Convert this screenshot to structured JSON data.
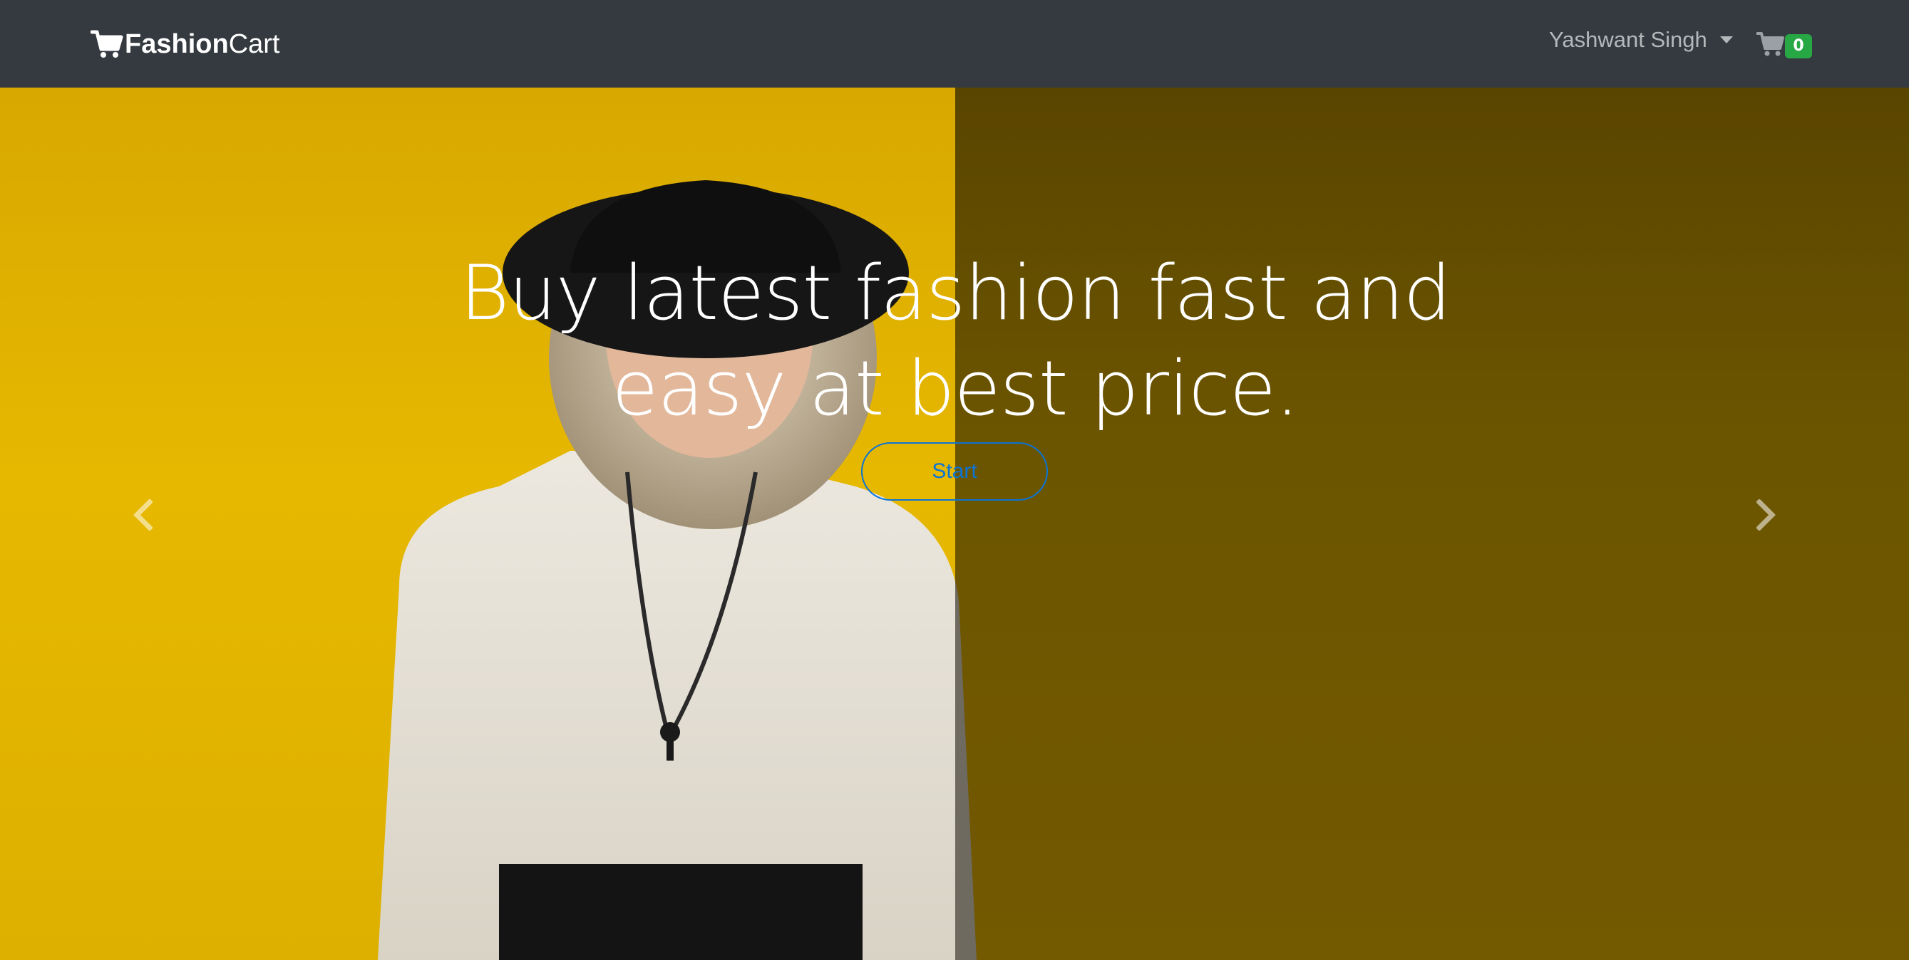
{
  "navbar": {
    "brand_bold": "Fashion",
    "brand_light": "Cart",
    "brand_icon": "shopping-cart-icon",
    "user_name": "Yashwant Singh",
    "cart_icon": "shopping-cart-icon",
    "cart_count": "0"
  },
  "hero": {
    "headline_line1": "Buy latest fashion fast and",
    "headline_line2": "easy at best price.",
    "start_label": "Start",
    "prev_icon": "chevron-left-icon",
    "next_icon": "chevron-right-icon"
  },
  "colors": {
    "navbar_bg": "#343a40",
    "badge_bg": "#28a745",
    "button_border": "#0a74d6",
    "background_yellow": "#e6b800"
  }
}
